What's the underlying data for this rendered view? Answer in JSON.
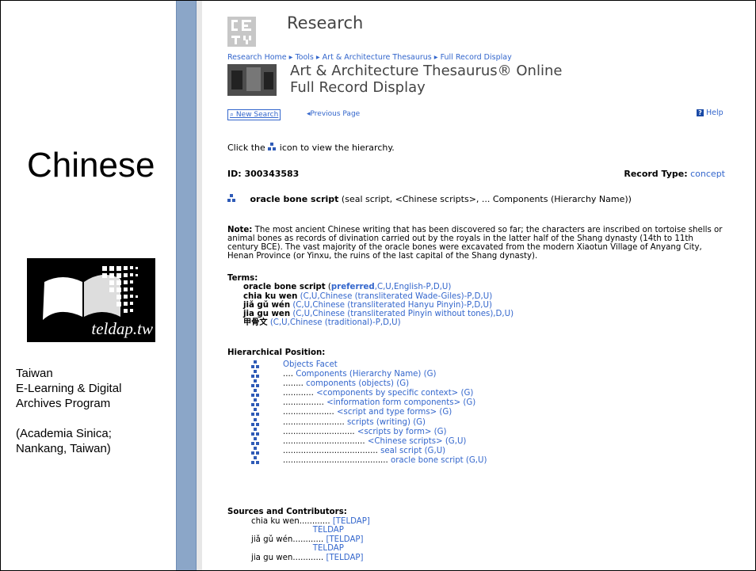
{
  "slide": {
    "title": "Chinese",
    "logo_text": "teldap.tw",
    "description_lines": [
      "Taiwan",
      "E-Learning & Digital",
      "Archives Program",
      "",
      "(Academia Sinica;",
      "Nankang, Taiwan)"
    ]
  },
  "page": {
    "header_title": "Research",
    "breadcrumb": "Research Home ▸ Tools ▸ Art & Architecture Thesaurus ▸ Full Record Display",
    "title_line1": "Art & Architecture Thesaurus® Online",
    "title_line2": "Full Record Display",
    "new_search": "New Search",
    "previous_page": "◂Previous Page",
    "help": "Help",
    "hint_before": "Click the ",
    "hint_after": " icon to view the hierarchy.",
    "id_label": "ID: 300343583",
    "record_type_label": "Record Type:",
    "record_type_value": "concept",
    "main_term_bold": "oracle bone script",
    "main_term_rest": " (seal script, <Chinese scripts>, ... Components (Hierarchy Name))",
    "note_label": "Note:",
    "note_text": " The most ancient Chinese writing that has been discovered so far; the characters are inscribed on tortoise shells or animal bones as records of divination carried out by the royals in the latter half of the Shang dynasty (14th to 11th century BCE). The vast majority of the oracle bones were excavated from the modern Xiaotun Village of Anyang City, Henan Province (or Yinxu, the ruins of the last capital of the Shang dynasty).",
    "terms_label": "Terms:",
    "terms": [
      {
        "term": "oracle bone script",
        "pre": " (",
        "pref": "preferred",
        "info": ",C,U,English-P,D,U)"
      },
      {
        "term": "chia ku wen",
        "pre": " ",
        "pref": "",
        "info": "(C,U,Chinese (transliterated Wade-Giles)-P,D,U)"
      },
      {
        "term": "jiǎ gǔ wén",
        "pre": " ",
        "pref": "",
        "info": "(C,U,Chinese (transliterated Hanyu Pinyin)-P,D,U)"
      },
      {
        "term": "jia gu wen",
        "pre": " ",
        "pref": "",
        "info": "(C,U,Chinese (transliterated Pinyin without tones),D,U)"
      },
      {
        "term": "甲骨文",
        "pre": " ",
        "pref": "",
        "info": "(C,U,Chinese (traditional)-P,D,U)"
      }
    ],
    "hierarchy_label": "Hierarchical Position:",
    "hierarchy": [
      {
        "dots": "",
        "label": "Objects Facet",
        "suffix": ""
      },
      {
        "dots": ".... ",
        "label": "Components (Hierarchy Name)",
        "suffix": " (G)"
      },
      {
        "dots": "........ ",
        "label": "components (objects)",
        "suffix": " (G)"
      },
      {
        "dots": "............ ",
        "label": "<components by specific context>",
        "suffix": " (G)"
      },
      {
        "dots": "................ ",
        "label": "<information form components>",
        "suffix": " (G)"
      },
      {
        "dots": ".................... ",
        "label": "<script and type forms>",
        "suffix": " (G)"
      },
      {
        "dots": "........................ ",
        "label": "scripts (writing)",
        "suffix": " (G)"
      },
      {
        "dots": "............................ ",
        "label": "<scripts by form>",
        "suffix": " (G)"
      },
      {
        "dots": "................................ ",
        "label": "<Chinese scripts>",
        "suffix": " (G,U)"
      },
      {
        "dots": "..................................... ",
        "label": "seal script",
        "suffix": " (G,U)"
      },
      {
        "dots": "......................................... ",
        "label": "oracle bone script",
        "suffix": " (G,U)"
      }
    ],
    "sources_label": "Sources and Contributors:",
    "sources": [
      {
        "text": "chia ku wen............ ",
        "link": "[TELDAP]"
      },
      {
        "text": "                        ",
        "link": "TELDAP"
      },
      {
        "text": "jiǎ gǔ wén............ ",
        "link": "[TELDAP]"
      },
      {
        "text": "                        ",
        "link": "TELDAP"
      },
      {
        "text": "jia gu wen............ ",
        "link": "[TELDAP]"
      }
    ]
  },
  "colors": {
    "link": "#3366cc",
    "sidebar_bar": "#8ba6c8"
  }
}
